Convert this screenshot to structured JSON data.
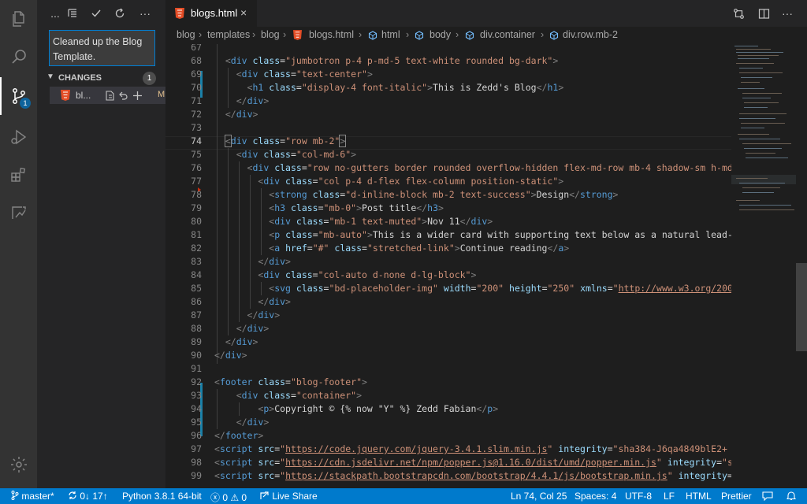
{
  "sidebar": {
    "commit_message": "Cleaned up the Blog Template.",
    "changes_label": "CHANGES",
    "changes_count": "1",
    "file": {
      "name": "bl...",
      "status": "M"
    },
    "toolbar": {
      "more": "...",
      "overflow": "···"
    }
  },
  "activity": {
    "scm_badge": "1"
  },
  "tab": {
    "label": "blogs.html",
    "close": "×"
  },
  "breadcrumb": {
    "items": [
      "blog",
      "templates",
      "blog",
      "blogs.html",
      "html",
      "body",
      "div.container",
      "div.row.mb-2"
    ],
    "sep": "›"
  },
  "editor": {
    "line_numbers": [
      "67",
      "68",
      "69",
      "70",
      "71",
      "72",
      "73",
      "74",
      "75",
      "76",
      "77",
      "78",
      "79",
      "80",
      "81",
      "82",
      "83",
      "84",
      "85",
      "86",
      "87",
      "88",
      "89",
      "90",
      "91",
      "92",
      "93",
      "94",
      "95",
      "96",
      "97",
      "98",
      "99"
    ]
  },
  "status": {
    "branch": "master*",
    "sync": "0↓ 17↑",
    "python": "Python 3.8.1 64-bit",
    "problems": "ⓧ 0 ⚠ 0",
    "live_share": "Live Share",
    "position": "Ln 74, Col 25",
    "spaces": "Spaces: 4",
    "encoding": "UTF-8",
    "eol": "LF",
    "language": "HTML",
    "formatter": "Prettier"
  },
  "colors": {
    "accent": "#007acc",
    "tag": "#569cd6",
    "attr": "#9cdcfe",
    "string": "#ce9178"
  }
}
